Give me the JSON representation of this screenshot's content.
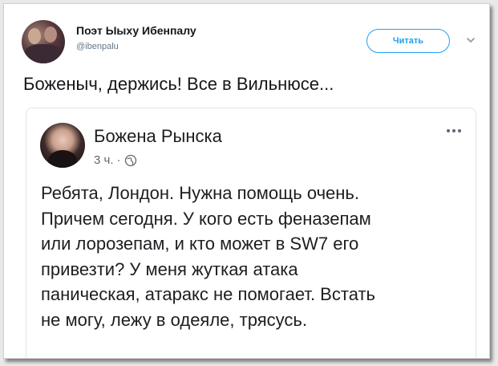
{
  "tweet": {
    "author_name": "Поэт Ыыху Ибенпалу",
    "author_handle": "@ibenpalu",
    "follow_label": "Читать",
    "text": "Боженыч, держись! Все в Вильнюсе..."
  },
  "embedded_post": {
    "author_name": "Божена Рынска",
    "time": "3 ч.",
    "separator": "·",
    "body_lines": [
      "Ребята, Лондон. Нужна помощь очень.",
      "Причем сегодня. У кого есть феназепам",
      "или лорозепам, и кто может в SW7 его",
      "привезти? У меня жуткая атака",
      "паническая, атаракс не помогает. Встать",
      "не могу, лежу в одеяле, трясусь."
    ]
  },
  "icons": {
    "caret": "chevron-down-icon",
    "globe": "globe-icon",
    "more": "more-dots-icon"
  },
  "colors": {
    "twitter_blue": "#1da1f2",
    "text_dark": "#14171a",
    "meta_gray": "#657786"
  }
}
